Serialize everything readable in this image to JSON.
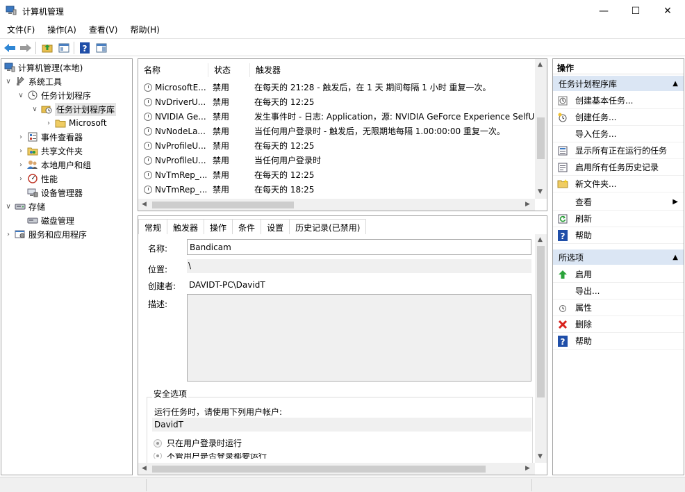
{
  "window": {
    "title": "计算机管理"
  },
  "menu": [
    "文件(F)",
    "操作(A)",
    "查看(V)",
    "帮助(H)"
  ],
  "tree": [
    {
      "label": "计算机管理(本地)",
      "icon": "computer-icon",
      "expander": ""
    },
    {
      "label": "系统工具",
      "icon": "tools-icon",
      "expander": "∨"
    },
    {
      "label": "任务计划程序",
      "icon": "clock-icon",
      "expander": "∨"
    },
    {
      "label": "任务计划程序库",
      "icon": "folder-clock-icon",
      "expander": "∨"
    },
    {
      "label": "Microsoft",
      "icon": "folder-icon",
      "expander": "›"
    },
    {
      "label": "事件查看器",
      "icon": "event-viewer-icon",
      "expander": "›"
    },
    {
      "label": "共享文件夹",
      "icon": "shared-folder-icon",
      "expander": "›"
    },
    {
      "label": "本地用户和组",
      "icon": "users-icon",
      "expander": "›"
    },
    {
      "label": "性能",
      "icon": "performance-icon",
      "expander": "›"
    },
    {
      "label": "设备管理器",
      "icon": "device-manager-icon",
      "expander": ""
    },
    {
      "label": "存储",
      "icon": "storage-icon",
      "expander": "∨"
    },
    {
      "label": "磁盘管理",
      "icon": "disk-icon",
      "expander": ""
    },
    {
      "label": "服务和应用程序",
      "icon": "services-icon",
      "expander": "›"
    }
  ],
  "task_list": {
    "columns": [
      "名称",
      "状态",
      "触发器"
    ],
    "rows": [
      {
        "name": "MicrosoftE...",
        "status": "禁用",
        "trigger": "在每天的 21:28 - 触发后，在 1 天 期间每隔 1 小时 重复一次。"
      },
      {
        "name": "NvDriverU...",
        "status": "禁用",
        "trigger": "在每天的 12:25"
      },
      {
        "name": "NVIDIA Ge...",
        "status": "禁用",
        "trigger": "发生事件时 - 日志: Application，源: NVIDIA GeForce Experience SelfUp"
      },
      {
        "name": "NvNodeLa...",
        "status": "禁用",
        "trigger": "当任何用户登录时 - 触发后，无限期地每隔 1.00:00:00 重复一次。"
      },
      {
        "name": "NvProfileU...",
        "status": "禁用",
        "trigger": "在每天的 12:25"
      },
      {
        "name": "NvProfileU...",
        "status": "禁用",
        "trigger": "当任何用户登录时"
      },
      {
        "name": "NvTmRep_...",
        "status": "禁用",
        "trigger": "在每天的 12:25"
      },
      {
        "name": "NvTmRep_...",
        "status": "禁用",
        "trigger": "在每天的 18:25"
      }
    ]
  },
  "details": {
    "tabs": [
      "常规",
      "触发器",
      "操作",
      "条件",
      "设置",
      "历史记录(已禁用)"
    ],
    "name_label": "名称:",
    "name_value": "Bandicam",
    "location_label": "位置:",
    "location_value": "\\",
    "author_label": "创建者:",
    "author_value": "DAVIDT-PC\\DavidT",
    "description_label": "描述:",
    "security_title": "安全选项",
    "run_as_text": "运行任务时，请使用下列用户帐户:",
    "run_as_user": "DavidT",
    "radio_1": "只在用户登录时运行",
    "radio_2": "不管用户是否登录都要运行"
  },
  "actions": {
    "title": "操作",
    "section1": "任务计划程序库",
    "items1": [
      {
        "label": "创建基本任务...",
        "icon": "create-basic-task-icon"
      },
      {
        "label": "创建任务...",
        "icon": "create-task-icon"
      },
      {
        "label": "导入任务...",
        "icon": ""
      },
      {
        "label": "显示所有正在运行的任务",
        "icon": "running-tasks-icon"
      },
      {
        "label": "启用所有任务历史记录",
        "icon": "history-icon"
      },
      {
        "label": "新文件夹...",
        "icon": "new-folder-icon"
      },
      {
        "label": "查看",
        "icon": ""
      },
      {
        "label": "刷新",
        "icon": "refresh-icon"
      },
      {
        "label": "帮助",
        "icon": "help-icon"
      }
    ],
    "section2": "所选项",
    "items2": [
      {
        "label": "启用",
        "icon": "enable-icon"
      },
      {
        "label": "导出...",
        "icon": ""
      },
      {
        "label": "属性",
        "icon": "properties-icon"
      },
      {
        "label": "删除",
        "icon": "delete-icon"
      },
      {
        "label": "帮助",
        "icon": "help-icon"
      }
    ]
  },
  "colors": {
    "section_header": "#dbe6f4",
    "help_blue": "#1f4ea8",
    "delete_red": "#d9231d",
    "enable_green": "#2aa33a"
  }
}
